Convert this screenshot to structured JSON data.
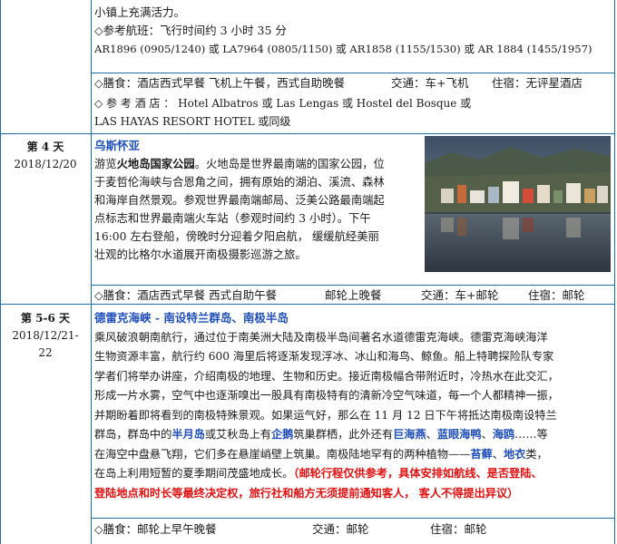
{
  "day3_tail": {
    "line1": "小镇上充满活力。",
    "flight_label": "◇参考航班：飞行时间约 3 小时 35 分",
    "flights": "AR1896 (0905/1240) 或 LA7964 (0805/1150) 或 AR1858 (1155/1530) 或 AR 1884 (1455/1957)",
    "meal_label": "◇膳食：酒店西式早餐 飞机上午餐，西式自助晚餐",
    "transport": "交通：车+飞机",
    "stay": "住宿：无评星酒店",
    "hotel_line1": "◇ 参 考 酒 店 ： Hotel  Albatros  或  Las  Lengas  或  Hostel  del  Bosque  或",
    "hotel_line2": "LAS  HAYAS  RESORT  HOTEL  或同级"
  },
  "day4": {
    "day": "第 4 天",
    "date": "2018/12/20",
    "title": "乌斯怀亚",
    "p1a": "游览",
    "p1b": "火地岛国家公园",
    "p1c": "。火地岛是世界最南端的国家公园，位",
    "p2": "于麦哲伦海峡与合恩角之间，拥有原始的湖泊、溪流、森林",
    "p3": "和海岸自然景观。参观世界最南端邮局、泛美公路最南端起",
    "p4": "点标志和世界最南端火车站（参观时间约 3 小时）。下午",
    "p5": "16:00 左右登船，傍晚时分迎着夕阳启航，  缓缓航经美丽",
    "p6": "壮观的比格尔水道展开南极摄影巡游之旅。",
    "meal": "◇膳食：酒店西式早餐 西式自助午餐",
    "meal_dinner": "邮轮上晚餐",
    "transport": "交通：车+邮轮",
    "stay": "住宿：邮轮",
    "photo_icon": "harbor-town-photo"
  },
  "day56": {
    "day": "第 5-6 天",
    "date1": "2018/12/21-",
    "date2": "22",
    "title": "德雷克海峡 - 南设特兰群岛、南极半岛",
    "l1": "乘风破浪朝南航行，通过位于南美洲大陆及南极半岛间著名水道德雷克海峡。德雷克海峡海洋",
    "l2": "生物资源丰富，航行约 600 海里后将逐渐发现浮冰、冰山和海鸟、鲸鱼。船上特聘探险队专家",
    "l3": "学者们将举办讲座，介绍南极的地理、生物和历史。接近南极幅合带附近时，冷热水在此交汇，",
    "l4": "形成一片水雾，空气中也逐渐嗅出一股具有南极特有的清新冷空气味道，每一个人都精神一振，",
    "l5": "并期盼着即将看到的南极特殊景观。如果运气好，那么在 11 月 12 日下午将抵达南极南设特兰",
    "l6a": "群岛，群岛中的",
    "l6b": "半月岛",
    "l6c": "或艾秋岛上有",
    "l6d": "企鹅",
    "l6e": "筑巢群栖，此外还有",
    "l6f": "巨海燕",
    "l6g": "、",
    "l6h": "蓝眼海鸭",
    "l6i": "、",
    "l6j": "海鸥",
    "l6k": "……等",
    "l7a": "在海空中盘悬飞翔，它们多在悬崖峭壁上筑巢。南极陆地罕有的两种植物——",
    "l7b": "苔藓",
    "l7c": "、",
    "l7d": "地衣",
    "l7e": "类，",
    "l8a": "在岛上利用短暂的夏季期间茂盛地成长。",
    "l8b": "（邮轮行程仅供参考，具体安排如航线、是否登陆、",
    "l9": "登陆地点和时长等最终决定权，旅行社和船方无须提前通知客人，  客人不得提出异议）",
    "meal": "◇膳食：邮轮上早午晚餐",
    "transport": "交通：邮轮",
    "stay": "住宿：邮轮"
  }
}
